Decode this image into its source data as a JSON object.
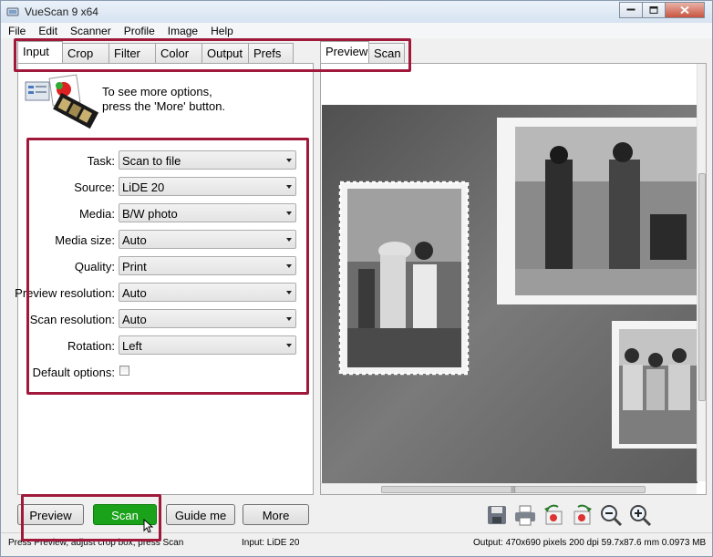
{
  "window": {
    "title": "VueScan 9 x64"
  },
  "menu": [
    "File",
    "Edit",
    "Scanner",
    "Profile",
    "Image",
    "Help"
  ],
  "left_tabs": [
    "Input",
    "Crop",
    "Filter",
    "Color",
    "Output",
    "Prefs"
  ],
  "right_tabs": [
    "Preview",
    "Scan"
  ],
  "hint": {
    "line1": "To see more options,",
    "line2": "press the 'More' button."
  },
  "form": [
    {
      "label": "Task:",
      "value": "Scan to file"
    },
    {
      "label": "Source:",
      "value": "LiDE 20"
    },
    {
      "label": "Media:",
      "value": "B/W photo"
    },
    {
      "label": "Media size:",
      "value": "Auto"
    },
    {
      "label": "Quality:",
      "value": "Print"
    },
    {
      "label": "Preview resolution:",
      "value": "Auto"
    },
    {
      "label": "Scan resolution:",
      "value": "Auto"
    },
    {
      "label": "Rotation:",
      "value": "Left"
    }
  ],
  "default_options": {
    "label": "Default options:",
    "checked": false
  },
  "buttons": {
    "preview": "Preview",
    "scan": "Scan",
    "guide": "Guide me",
    "more": "More"
  },
  "toolbar_icons": [
    "save-icon",
    "print-icon",
    "rotate-left-icon",
    "rotate-right-icon",
    "zoom-out-icon",
    "zoom-in-icon"
  ],
  "status": {
    "left": "Press Preview, adjust crop box, press Scan",
    "middle": "Input: LiDE 20",
    "right": "Output: 470x690 pixels 200 dpi 59.7x87.6 mm 0.0973 MB"
  },
  "colors": {
    "highlight": "#a0193a",
    "scan_button": "#1aa31a"
  }
}
